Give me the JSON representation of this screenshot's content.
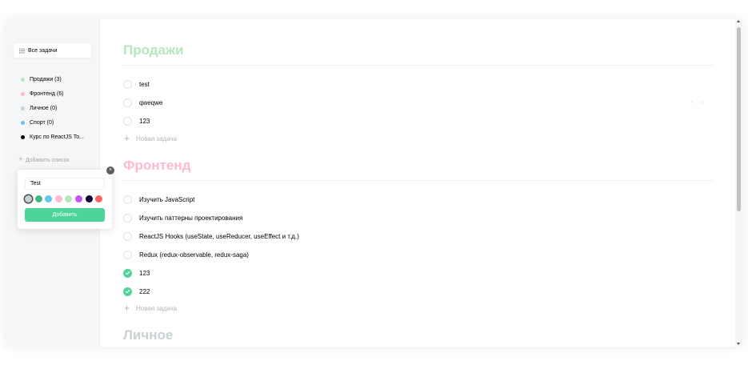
{
  "sidebar": {
    "all_tasks_label": "Все задачи",
    "items": [
      {
        "label": "Продажи (3)",
        "color": "#b6e6bd"
      },
      {
        "label": "Фронтенд (6)",
        "color": "#ffbbcc"
      },
      {
        "label": "Личное (0)",
        "color": "#c9d1d3"
      },
      {
        "label": "Спорт (0)",
        "color": "#64c4ed"
      },
      {
        "label": "Курс по ReactJS To...",
        "color": "#000000"
      }
    ],
    "add_list_label": "Добавить список"
  },
  "popup": {
    "input_value": "Test",
    "button_label": "Добавить",
    "close_glyph": "×",
    "swatches": [
      "#c9d1d3",
      "#42b883",
      "#64c4ed",
      "#ffbbcc",
      "#b6e6bd",
      "#c355f5",
      "#110133",
      "#ff6464"
    ]
  },
  "main": {
    "sections": [
      {
        "title": "Продажи",
        "color": "#b6e6bd",
        "tasks": [
          {
            "text": "test",
            "done": false
          },
          {
            "text": "qweqwe",
            "done": false
          },
          {
            "text": "123",
            "done": false
          }
        ],
        "add_task_label": "Новая задача"
      },
      {
        "title": "Фронтенд",
        "color": "#ffbbcc",
        "tasks": [
          {
            "text": "Изучить JavaScript",
            "done": false
          },
          {
            "text": "Изучить паттерны проектирования",
            "done": false
          },
          {
            "text": "ReactJS Hooks (useState, useReducer, useEffect и т.д.)",
            "done": false
          },
          {
            "text": "Redux (redux-observable, redux-saga)",
            "done": false
          },
          {
            "text": "123",
            "done": true
          },
          {
            "text": "222",
            "done": true
          }
        ],
        "add_task_label": "Новая задача"
      },
      {
        "title": "Личное",
        "color": "#c9d1d3"
      }
    ]
  }
}
